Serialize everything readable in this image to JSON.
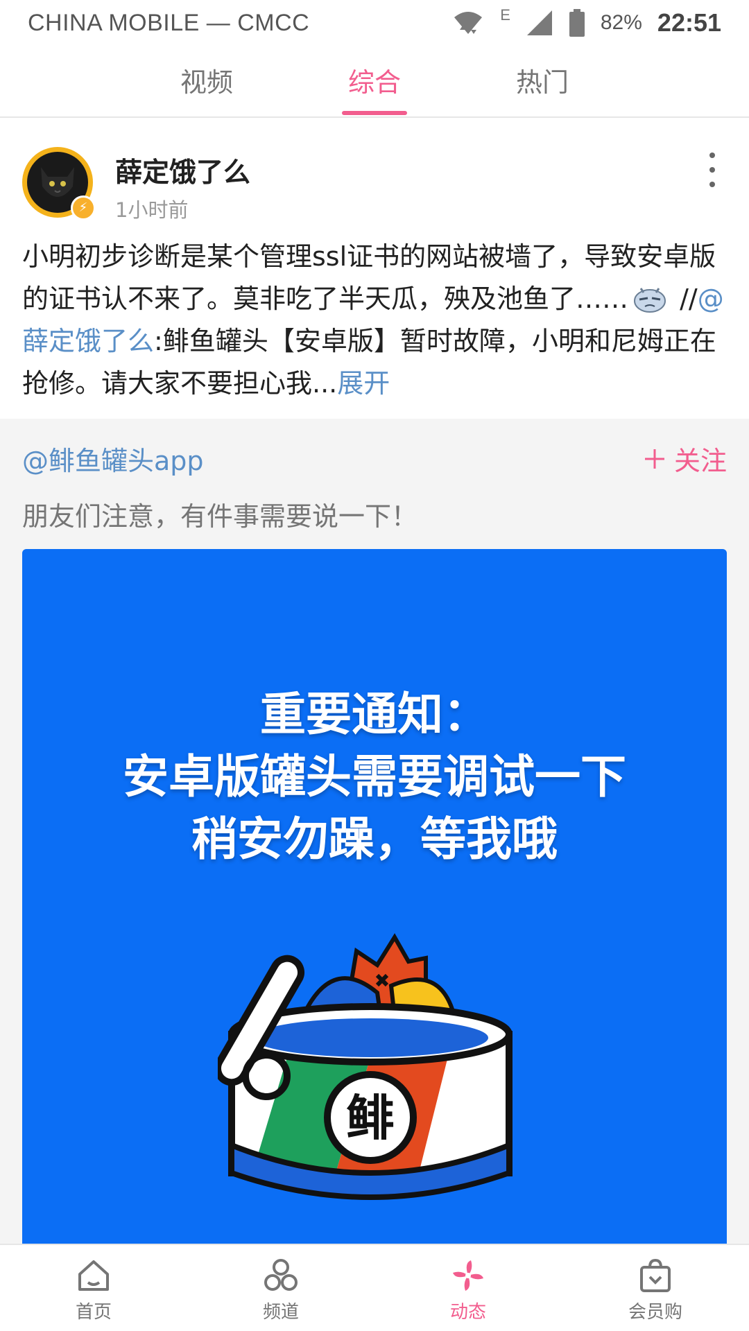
{
  "status_bar": {
    "carrier": "CHINA MOBILE — CMCC",
    "network_type": "E",
    "battery": "82%",
    "time": "22:51",
    "icons": [
      "wifi-icon",
      "signal-icon",
      "battery-icon"
    ]
  },
  "tabs": [
    {
      "label": "视频",
      "active": false
    },
    {
      "label": "综合",
      "active": true
    },
    {
      "label": "热门",
      "active": false
    }
  ],
  "post": {
    "username": "薛定饿了么",
    "time": "1小时前",
    "text_part1": "小明初步诊断是某个管理ssl证书的网站被墙了，导致安卓版的证书认不来了。莫非吃了半天瓜，殃及池鱼了……",
    "text_sep": " //",
    "mention": "@薛定饿了么",
    "text_part2": ":鲱鱼罐头【安卓版】暂时故障，小明和尼姆正在抢修。请大家不要担心我...",
    "expand": "展开"
  },
  "repost": {
    "author": "@鲱鱼罐头app",
    "follow": "关注",
    "text": "朋友们注意，有件事需要说一下！",
    "image_lines": [
      "重要通知：",
      "安卓版罐头需要调试一下",
      "稍安勿躁，等我哦"
    ],
    "image_logo_char": "鲱",
    "image_bg": "#0b6ef5"
  },
  "bottom_nav": [
    {
      "label": "首页",
      "icon": "home-icon",
      "active": false
    },
    {
      "label": "频道",
      "icon": "channels-icon",
      "active": false
    },
    {
      "label": "动态",
      "icon": "dynamic-icon",
      "active": true
    },
    {
      "label": "会员购",
      "icon": "shop-bag-icon",
      "active": false
    }
  ],
  "colors": {
    "accent": "#f25d8e",
    "link": "#5a8fc7",
    "text_primary": "#212121",
    "text_secondary": "#999999"
  }
}
